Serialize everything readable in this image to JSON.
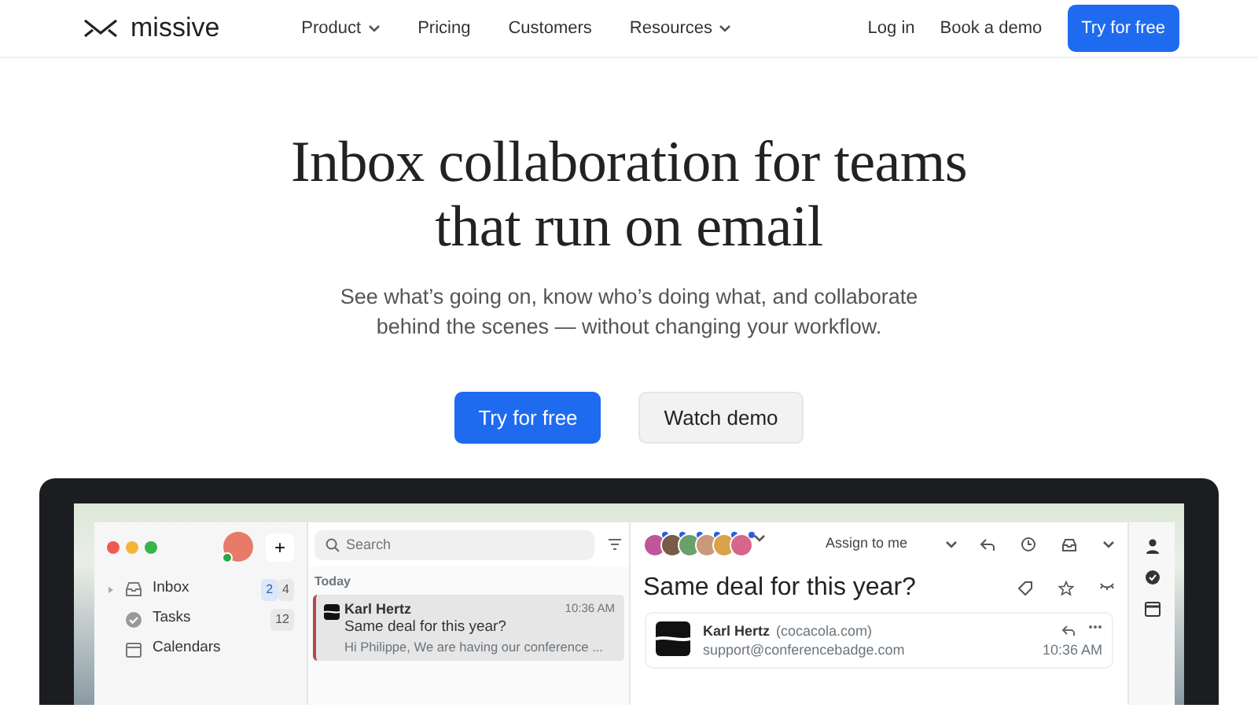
{
  "nav": {
    "brand": "missive",
    "links": [
      {
        "label": "Product",
        "dropdown": true
      },
      {
        "label": "Pricing",
        "dropdown": false
      },
      {
        "label": "Customers",
        "dropdown": false
      },
      {
        "label": "Resources",
        "dropdown": true
      }
    ],
    "login": "Log in",
    "demo": "Book a demo",
    "cta": "Try for free"
  },
  "hero": {
    "title": "Inbox collaboration for teams that run on email",
    "subtitle": "See what’s going on, know who’s doing what, and collaborate behind the scenes — without changing your workflow.",
    "primary": "Try for free",
    "secondary": "Watch demo"
  },
  "app": {
    "sidebar": {
      "items": [
        {
          "label": "Inbox",
          "expandable": true,
          "counts": [
            {
              "text": "2",
              "highlighted": true
            },
            {
              "text": "4",
              "highlighted": false
            }
          ]
        },
        {
          "label": "Tasks",
          "expandable": false,
          "counts": [
            {
              "text": "12",
              "highlighted": false
            }
          ]
        },
        {
          "label": "Calendars",
          "expandable": false
        }
      ],
      "compose": "+"
    },
    "search": {
      "placeholder": "Search"
    },
    "list": {
      "section": "Today",
      "conversations": [
        {
          "sender": "Karl Hertz",
          "time": "10:36 AM",
          "subject": "Same deal for this year?",
          "preview": "Hi Philippe, We are having our conference ...",
          "selected": true
        }
      ]
    },
    "participants": [
      {
        "color": "#c0569a"
      },
      {
        "color": "#7a5a48"
      },
      {
        "color": "#6aa06a"
      },
      {
        "color": "#c99a7a"
      },
      {
        "color": "#d8a24a"
      },
      {
        "color": "#d7668c"
      }
    ],
    "assign": "Assign to me",
    "conversation": {
      "subject": "Same deal for this year?",
      "message": {
        "sender": "Karl Hertz",
        "domain": "(cocacola.com)",
        "email": "support@conferencebadge.com",
        "time": "10:36 AM"
      }
    }
  }
}
